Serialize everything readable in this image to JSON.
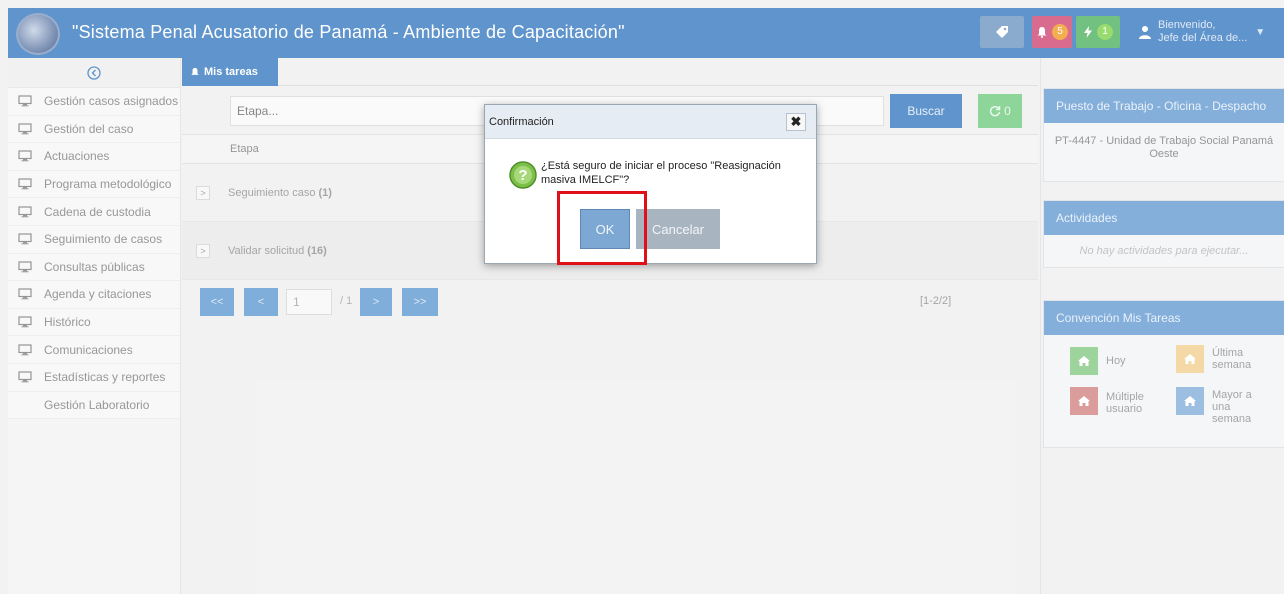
{
  "header": {
    "title": "\"Sistema Penal Acusatorio de Panamá - Ambiente de Capacitación\"",
    "notifications_count": "5",
    "activity_count": "1",
    "user_greeting": "Bienvenido,",
    "user_role": "Jefe del Área de..."
  },
  "sidebar": {
    "items": [
      {
        "label": "Gestión casos asignados",
        "icon": "monitor-icon"
      },
      {
        "label": "Gestión del caso",
        "icon": "monitor-icon"
      },
      {
        "label": "Actuaciones",
        "icon": "monitor-icon"
      },
      {
        "label": "Programa metodológico",
        "icon": "monitor-icon"
      },
      {
        "label": "Cadena de custodia",
        "icon": "monitor-icon"
      },
      {
        "label": "Seguimiento de casos",
        "icon": "monitor-icon"
      },
      {
        "label": "Consultas públicas",
        "icon": "monitor-icon"
      },
      {
        "label": "Agenda y citaciones",
        "icon": "monitor-icon"
      },
      {
        "label": "Histórico",
        "icon": "monitor-icon"
      },
      {
        "label": "Comunicaciones",
        "icon": "monitor-icon"
      },
      {
        "label": "Estadísticas y reportes",
        "icon": "monitor-icon"
      },
      {
        "label": "Gestión Laboratorio",
        "icon": ""
      }
    ]
  },
  "main": {
    "tab_label": "Mis tareas",
    "search_placeholder": "Etapa...",
    "search_button": "Buscar",
    "refresh_count": "0",
    "table": {
      "column": "Etapa",
      "rows": [
        {
          "label": "Seguimiento caso",
          "count": "(1)"
        },
        {
          "label": "Validar solicitud",
          "count": "(16)"
        }
      ]
    },
    "pager": {
      "first": "<<",
      "prev": "<",
      "page": "1",
      "total": "/ 1",
      "next": ">",
      "last": ">>",
      "range": "[1-2/2]"
    }
  },
  "right": {
    "workstation_title": "Puesto de Trabajo - Oficina - Despacho",
    "workstation_value": "PT-4447 - Unidad de Trabajo Social Panamá Oeste",
    "activities_title": "Actividades",
    "activities_empty": "No hay actividades para ejecutar...",
    "legend_title": "Convención Mis Tareas",
    "legend": [
      {
        "label": "Hoy",
        "color": "#8fcf8f"
      },
      {
        "label": "Última semana",
        "color": "#f3d39a"
      },
      {
        "label": "Múltiple usuario",
        "color": "#d78f8f"
      },
      {
        "label": "Mayor a una semana",
        "color": "#8fb5dd"
      }
    ]
  },
  "modal": {
    "title": "Confirmación",
    "message": "¿Está seguro de iniciar el proceso \"Reasignación masiva IMELCF\"?",
    "ok": "OK",
    "cancel": "Cancelar"
  },
  "colors": {
    "primary": "#4a86c5",
    "highlight": "#e0101a"
  }
}
